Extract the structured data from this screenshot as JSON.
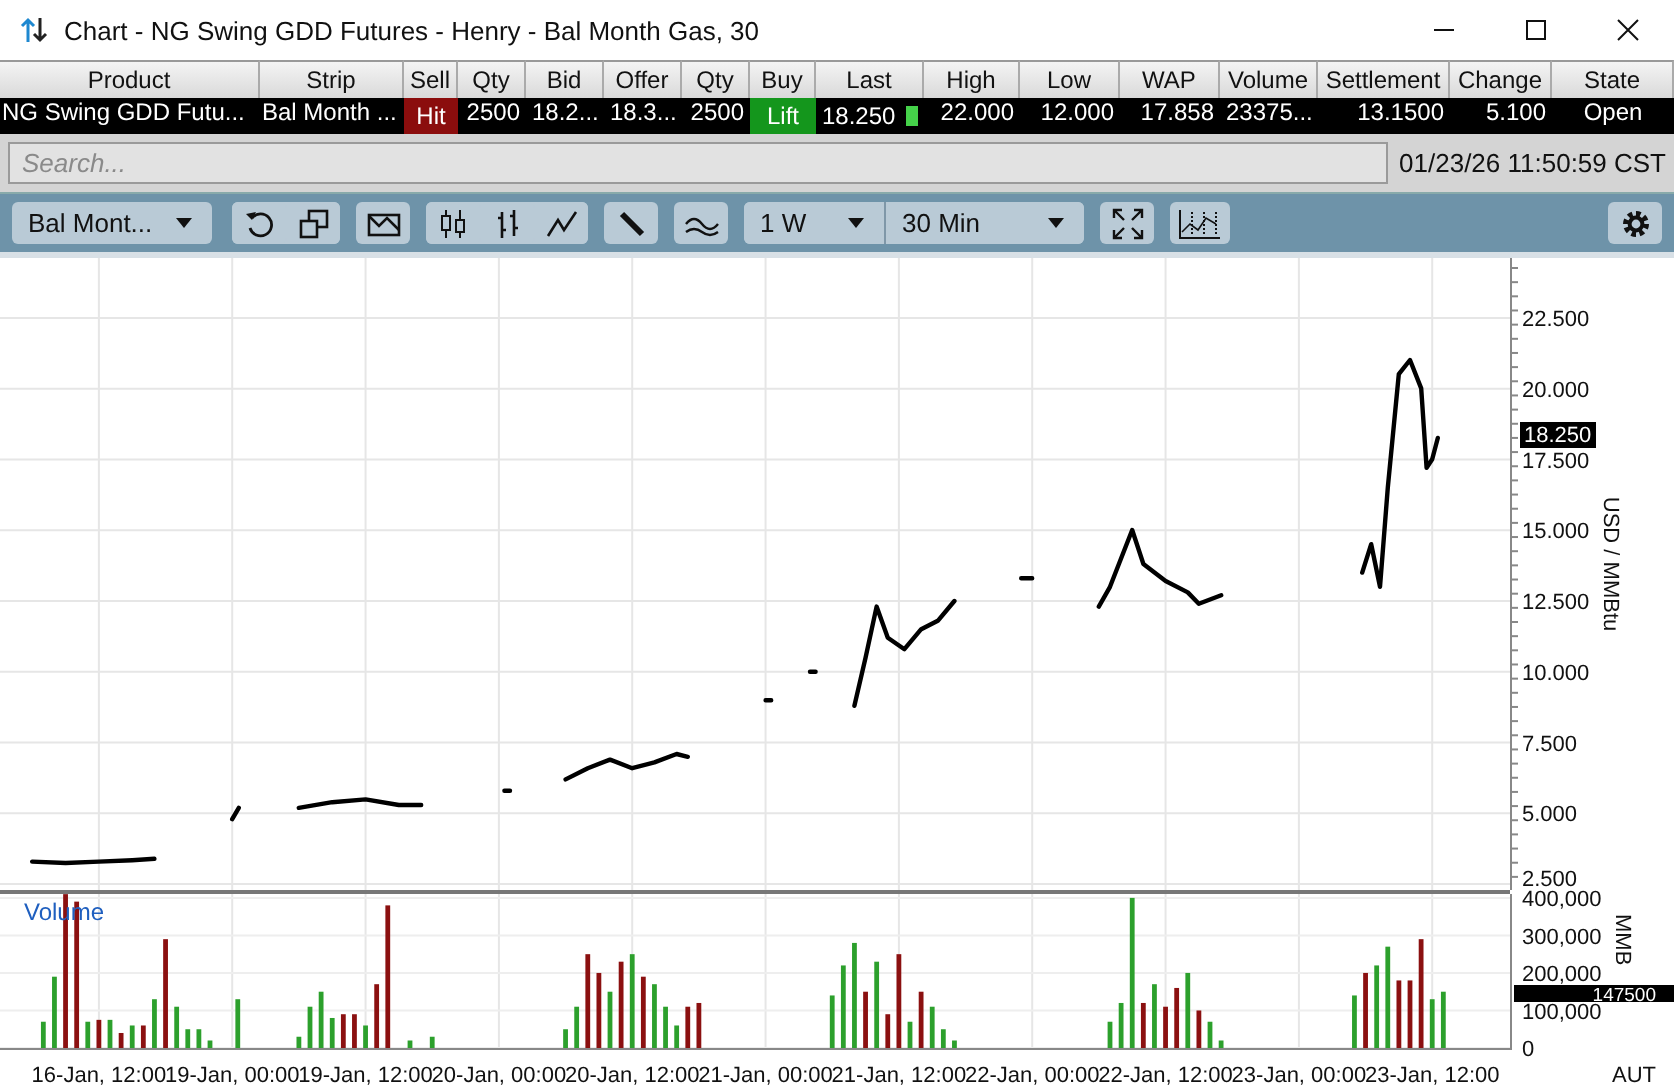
{
  "window": {
    "title": "Chart - NG Swing GDD Futures - Henry - Bal Month Gas, 30"
  },
  "quote_table": {
    "columns": [
      "Product",
      "Strip",
      "Sell",
      "Qty",
      "Bid",
      "Offer",
      "Qty",
      "Buy",
      "Last",
      "High",
      "Low",
      "WAP",
      "Volume",
      "Settlement",
      "Change",
      "State"
    ],
    "cells": [
      {
        "kind": "label",
        "text": "NG Swing GDD Futu..."
      },
      {
        "kind": "label",
        "text": "Bal Month ..."
      },
      {
        "kind": "hit",
        "text": "Hit"
      },
      {
        "kind": "number",
        "text": "2500"
      },
      {
        "kind": "number",
        "text": "18.2..."
      },
      {
        "kind": "number",
        "text": "18.3..."
      },
      {
        "kind": "number",
        "text": "2500"
      },
      {
        "kind": "lift",
        "text": "Lift"
      },
      {
        "kind": "last",
        "text": "18.250"
      },
      {
        "kind": "number",
        "text": "22.000"
      },
      {
        "kind": "number",
        "text": "12.000"
      },
      {
        "kind": "number",
        "text": "17.858"
      },
      {
        "kind": "number",
        "text": "23375..."
      },
      {
        "kind": "number",
        "text": "13.1500"
      },
      {
        "kind": "number",
        "text": "5.100"
      },
      {
        "kind": "state",
        "text": "Open"
      }
    ]
  },
  "search": {
    "placeholder": "Search...",
    "timestamp": "01/23/26 11:50:59 CST"
  },
  "toolbar": {
    "contract_dropdown": "Bal Mont...",
    "range_dropdown": "1 W",
    "interval_dropdown": "30 Min"
  },
  "price_chart": {
    "axis_title": "USD / MMBtu",
    "last_price_tag": "18.250",
    "axis_labels": [
      "22.500",
      "20.000",
      "17.500",
      "15.000",
      "12.500",
      "10.000",
      "7.500",
      "5.000",
      "2.500"
    ]
  },
  "volume_chart": {
    "title": "Volume",
    "axis_title": "MMB",
    "volume_tag": "147500",
    "axis_labels": [
      "400,000",
      "300,000",
      "200,000",
      "100,000",
      "0"
    ],
    "time_labels": [
      "16-Jan, 12:00",
      "19-Jan, 00:00",
      "19-Jan, 12:00",
      "20-Jan, 00:00",
      "20-Jan, 12:00",
      "21-Jan, 00:00",
      "21-Jan, 12:00",
      "22-Jan, 00:00",
      "22-Jan, 12:00",
      "23-Jan, 00:00",
      "23-Jan, 12:00"
    ],
    "axis_cut_label": "AUT"
  }
}
